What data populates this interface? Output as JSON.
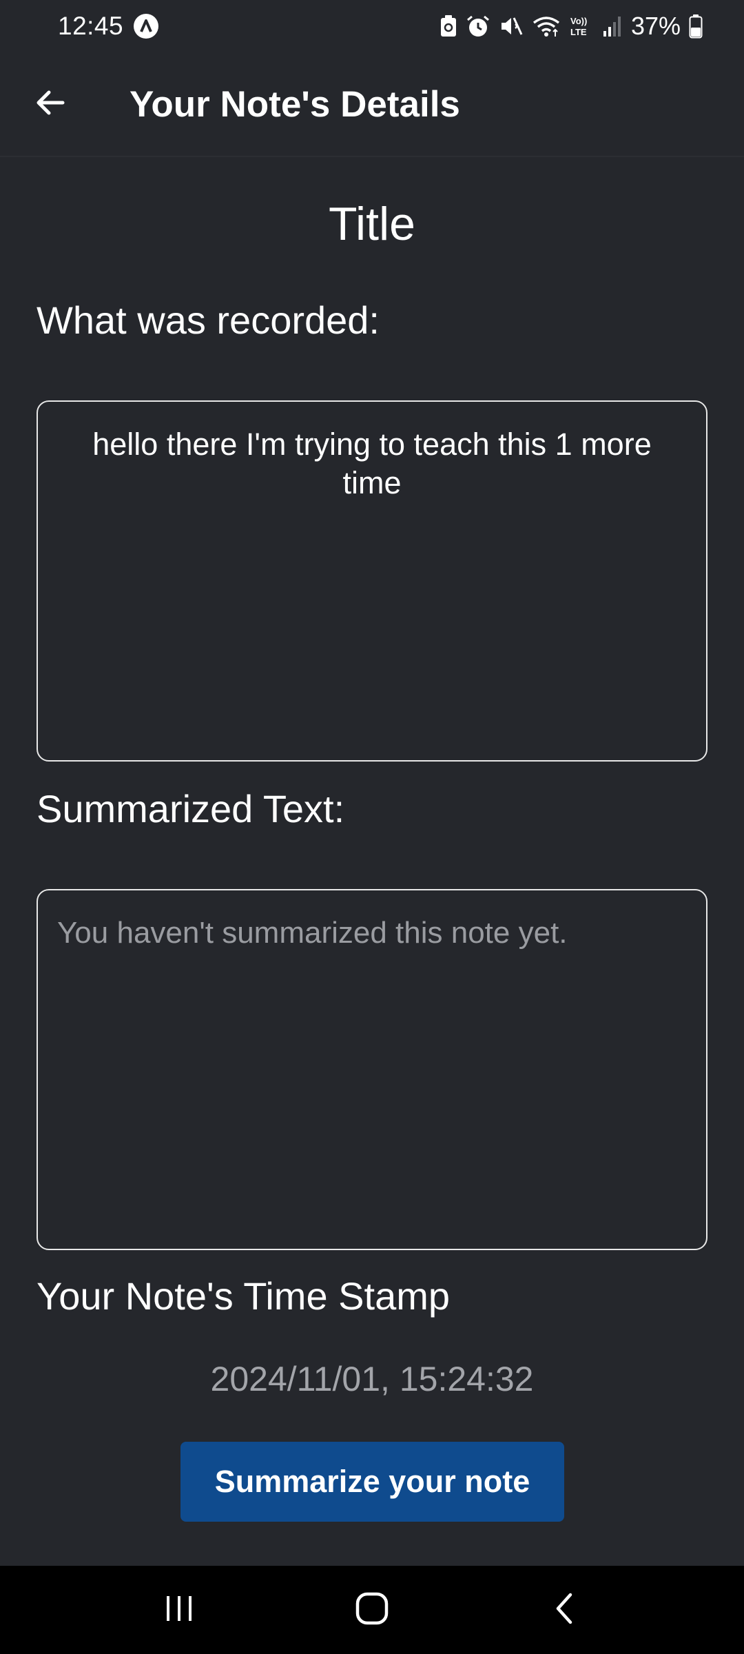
{
  "status_bar": {
    "time": "12:45",
    "battery": "37%",
    "icons": [
      "app-notification-icon",
      "battery-saver-icon",
      "alarm-icon",
      "mute-icon",
      "wifi-icon",
      "volte-icon",
      "signal-icon",
      "battery-icon"
    ]
  },
  "app_bar": {
    "title": "Your Note's Details",
    "back_icon": "arrow-left-icon"
  },
  "note": {
    "title": "Title",
    "recorded_label": "What was recorded:",
    "recorded_text": "hello there I'm trying to teach this 1 more time",
    "summary_label": "Summarized Text:",
    "summary_placeholder": "You haven't summarized this note yet.",
    "summary_value": "",
    "timestamp_label": "Your Note's Time Stamp",
    "timestamp_value": "2024/11/01, 15:24:32"
  },
  "actions": {
    "summarize_label": "Summarize your note"
  },
  "nav_bar": {
    "icons": [
      "recent-apps-icon",
      "home-icon",
      "back-icon"
    ]
  },
  "colors": {
    "background": "#25272c",
    "button": "#0f4b8e",
    "placeholder": "#9a9ca1",
    "timestamp": "#a3a5aa",
    "nav_bar": "#000000"
  }
}
